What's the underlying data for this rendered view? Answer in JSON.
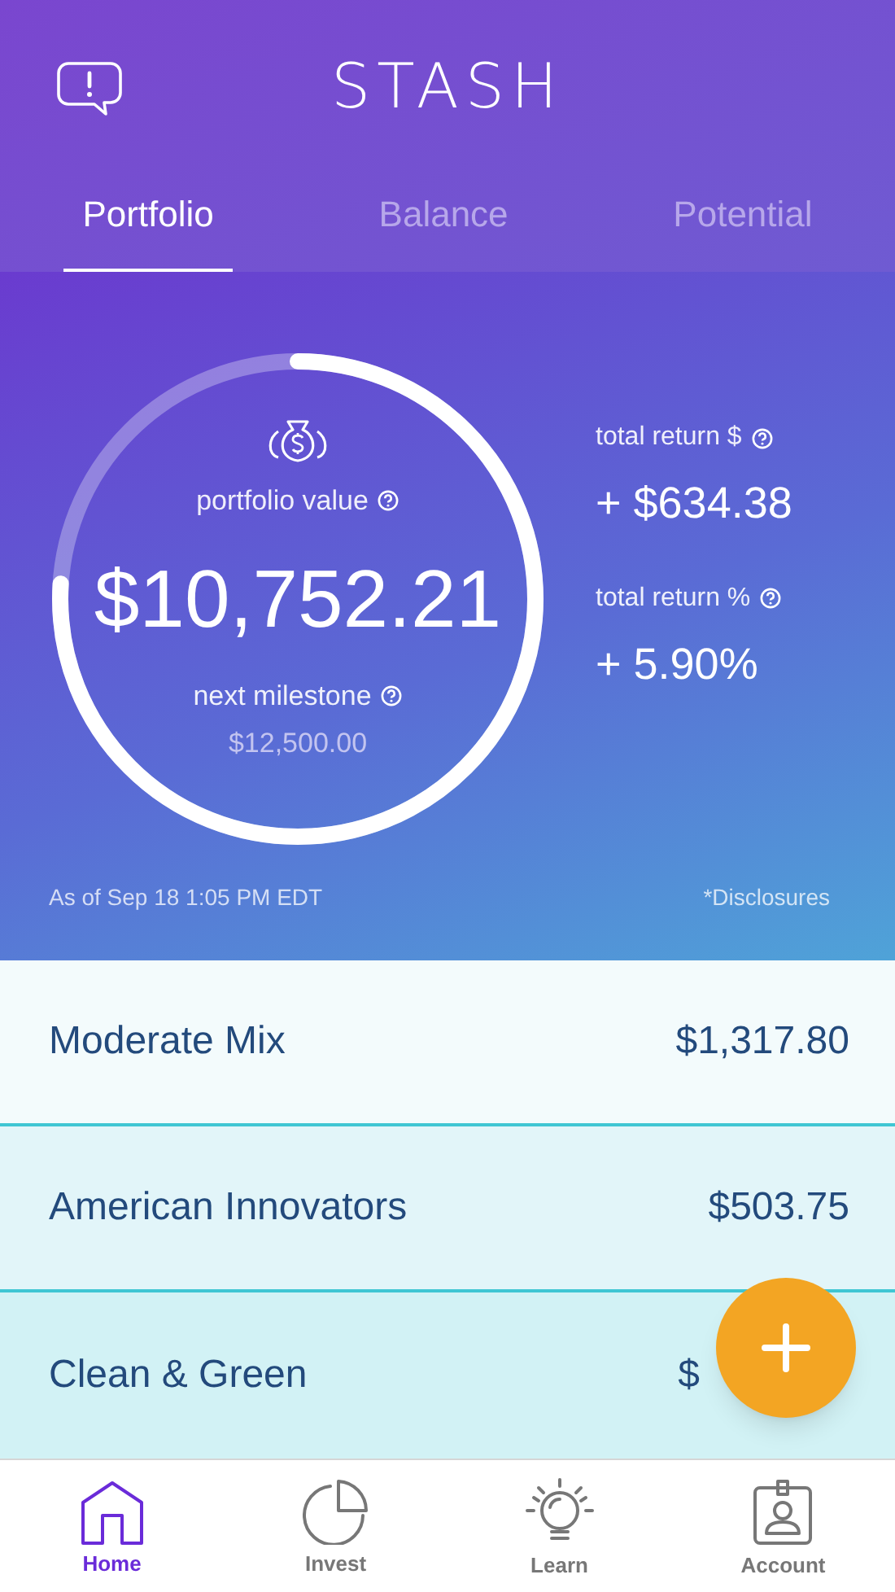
{
  "header": {
    "logo": "STASH"
  },
  "tabs": [
    {
      "label": "Portfolio",
      "selected": true
    },
    {
      "label": "Balance",
      "selected": false
    },
    {
      "label": "Potential",
      "selected": false
    }
  ],
  "summary": {
    "label": "portfolio value",
    "value": "$10,752.21",
    "milestone_label": "next milestone",
    "milestone_value": "$12,500.00",
    "level": 0.76,
    "returns": [
      {
        "label": "total return $",
        "value": "+ $634.38"
      },
      {
        "label": "total return %",
        "value": "+ 5.90%"
      }
    ],
    "as_of": "As of Sep 18 1:05 PM EDT",
    "disclosures": "*Disclosures"
  },
  "investments": [
    {
      "name": "Moderate Mix",
      "value": "$1,317.80"
    },
    {
      "name": "American Innovators",
      "value": "$503.75"
    },
    {
      "name": "Clean & Green",
      "value": "$"
    }
  ],
  "nav": [
    {
      "label": "Home",
      "kind": "home",
      "selected": true
    },
    {
      "label": "Invest",
      "kind": "invest",
      "selected": false
    },
    {
      "label": "Learn",
      "kind": "learn",
      "selected": false
    },
    {
      "label": "Account",
      "kind": "account",
      "selected": false
    }
  ]
}
